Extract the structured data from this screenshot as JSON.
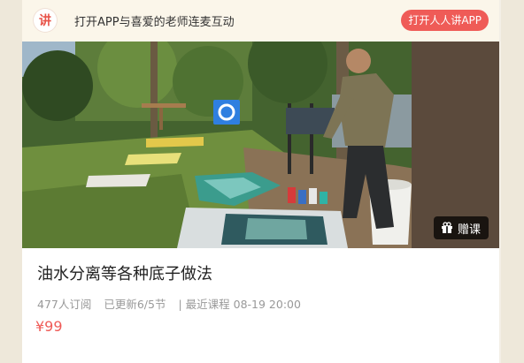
{
  "banner": {
    "logo_text": "讲",
    "text": "打开APP与喜爱的老师连麦互动",
    "open_button": "打开人人讲APP"
  },
  "cover": {
    "gift_label": "赠课"
  },
  "course": {
    "title": "油水分离等各种底子做法",
    "subscribers": "477人订阅",
    "updated": "已更新6/5节",
    "recent": "| 最近课程 08-19 20:00",
    "price": "¥99"
  },
  "colors": {
    "accent": "#ef5b57",
    "banner_bg": "#fbf6ea"
  }
}
